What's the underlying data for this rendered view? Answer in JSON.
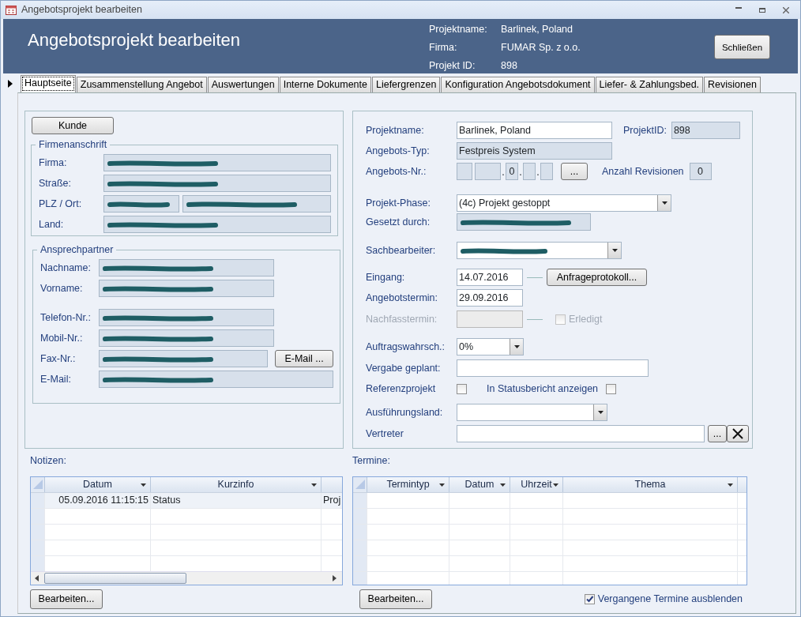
{
  "window": {
    "title": "Angebotsprojekt bearbeiten"
  },
  "header": {
    "title": "Angebotsprojekt bearbeiten",
    "info": [
      {
        "label": "Projektname:",
        "value": "Barlinek, Poland"
      },
      {
        "label": "Firma:",
        "value": "FUMAR Sp. z o.o."
      },
      {
        "label": "Projekt ID:",
        "value": "898"
      }
    ],
    "close_button": "Schließen"
  },
  "tabs": [
    {
      "label": "Hauptseite",
      "selected": true
    },
    {
      "label": "Zusammenstellung Angebot",
      "selected": false
    },
    {
      "label": "Auswertungen",
      "selected": false
    },
    {
      "label": "Interne Dokumente",
      "selected": false
    },
    {
      "label": "Liefergrenzen",
      "selected": false
    },
    {
      "label": "Konfiguration Angebotsdokument",
      "selected": false
    },
    {
      "label": "Liefer- & Zahlungsbed.",
      "selected": false
    },
    {
      "label": "Revisionen",
      "selected": false
    }
  ],
  "customer_panel": {
    "button": "Kunde",
    "address": {
      "legend": "Firmenanschrift",
      "rows": [
        {
          "label": "Firma:",
          "fields": [
            {
              "redacted": true
            }
          ]
        },
        {
          "label": "Straße:",
          "fields": [
            {
              "redacted": true
            }
          ]
        },
        {
          "label": "PLZ / Ort:",
          "fields": [
            {
              "redacted": true
            },
            {
              "redacted": true
            }
          ]
        },
        {
          "label": "Land:",
          "fields": [
            {
              "redacted": true
            }
          ]
        }
      ]
    },
    "contact": {
      "legend": "Ansprechpartner",
      "email_button": "E-Mail ...",
      "rows": [
        {
          "label": "Nachname:",
          "fields": [
            {
              "redacted": true
            }
          ]
        },
        {
          "label": "Vorname:",
          "fields": [
            {
              "redacted": true
            }
          ]
        },
        {
          "label": "Telefon-Nr.:",
          "fields": [
            {
              "redacted": true
            }
          ]
        },
        {
          "label": "Mobil-Nr.:",
          "fields": [
            {
              "redacted": true
            }
          ]
        },
        {
          "label": "Fax-Nr.:",
          "fields": [
            {
              "redacted": true
            }
          ]
        },
        {
          "label": "E-Mail:",
          "fields": [
            {
              "redacted": true
            }
          ]
        }
      ]
    }
  },
  "project_panel": {
    "projektname": {
      "label": "Projektname:",
      "value": "Barlinek, Poland"
    },
    "projekt_id": {
      "label": "ProjektID:",
      "value": "898"
    },
    "angebots_typ": {
      "label": "Angebots-Typ:",
      "value": "Festpreis System"
    },
    "angebots_nr": {
      "label": "Angebots-Nr.:",
      "middle_value": "0",
      "separators": [
        ".",
        ".",
        "."
      ],
      "button": "..."
    },
    "revisionen": {
      "label": "Anzahl Revisionen",
      "value": "0"
    },
    "phase": {
      "label": "Projekt-Phase:",
      "value": "(4c) Projekt gestoppt"
    },
    "gesetzt_durch": {
      "label": "Gesetzt durch:",
      "redacted": true
    },
    "sachbearbeiter": {
      "label": "Sachbearbeiter:",
      "redacted": true
    },
    "eingang": {
      "label": "Eingang:",
      "value": "14.07.2016"
    },
    "anfrage_button": "Anfrageprotokoll...",
    "angebotstermin": {
      "label": "Angebotstermin:",
      "value": "29.09.2016"
    },
    "nachfasstermin": {
      "label": "Nachfasstermin:",
      "disabled": true
    },
    "erledigt": {
      "label": "Erledigt",
      "checked": false,
      "disabled": true
    },
    "auftragswahrsch": {
      "label": "Auftragswahrsch.:",
      "value": "0%"
    },
    "vergabe": {
      "label": "Vergabe geplant:"
    },
    "referenz": {
      "label": "Referenzprojekt",
      "checked": false
    },
    "statusbericht": {
      "label": "In Statusbericht anzeigen",
      "checked": false
    },
    "ausfuehrungsland": {
      "label": "Ausführungsland:"
    },
    "vertreter": {
      "label": "Vertreter",
      "button": "..."
    }
  },
  "notes": {
    "label": "Notizen:",
    "columns": [
      "Datum",
      "Kurzinfo"
    ],
    "rows": [
      {
        "cells": [
          "05.09.2016 11:15:15",
          "Status",
          "Proj"
        ]
      }
    ],
    "edit_button": "Bearbeiten..."
  },
  "appointments": {
    "label": "Termine:",
    "columns": [
      "Termintyp",
      "Datum",
      "Uhrzeit",
      "Thema"
    ],
    "edit_button": "Bearbeiten...",
    "hide_past": {
      "label": "Vergangene Termine ausblenden",
      "checked": true
    }
  }
}
